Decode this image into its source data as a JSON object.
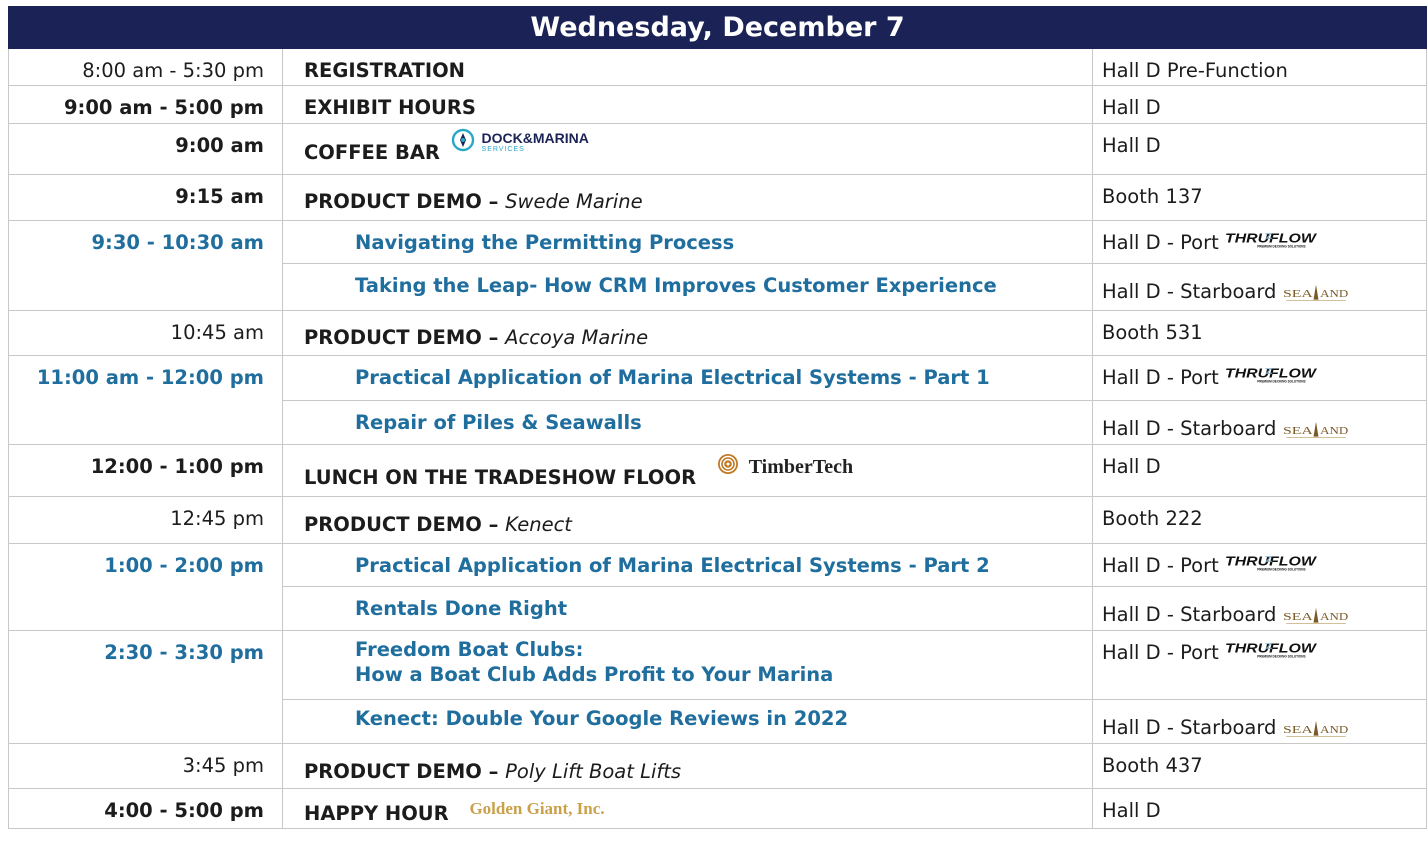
{
  "header": {
    "title": "Wednesday, December 7"
  },
  "rows": {
    "r1": {
      "time": "8:00 am - 5:30 pm",
      "event": "REGISTRATION",
      "location": "Hall D Pre-Function"
    },
    "r2": {
      "time": "9:00 am - 5:00 pm",
      "event": "EXHIBIT HOURS",
      "location": "Hall D"
    },
    "r3": {
      "time": "9:00 am",
      "event": "COFFEE BAR",
      "location": "Hall D",
      "sponsor": "DOCK&MARINA",
      "sponsor_sub": "SERVICES"
    },
    "r4": {
      "time": "9:15 am",
      "event": "PRODUCT DEMO –",
      "event_sub": "Swede Marine",
      "location": "Booth 137"
    },
    "r5": {
      "time": "9:30 - 10:30 am",
      "event": "Navigating the Permitting Process",
      "location": "Hall D - Port"
    },
    "r6": {
      "event": "Taking the Leap- How CRM Improves Customer Experience",
      "location": "Hall D - Starboard"
    },
    "r7": {
      "time": "10:45 am",
      "event": "PRODUCT DEMO –",
      "event_sub": "Accoya Marine",
      "location": "Booth 531"
    },
    "r8": {
      "time": "11:00 am - 12:00 pm",
      "event": "Practical Application of Marina Electrical Systems - Part 1",
      "location": "Hall D - Port"
    },
    "r9": {
      "event": "Repair of Piles & Seawalls",
      "location": "Hall D - Starboard"
    },
    "r10": {
      "time": "12:00 - 1:00 pm",
      "event": "LUNCH ON THE TRADESHOW FLOOR",
      "location": "Hall D",
      "sponsor": "TimberTech"
    },
    "r11": {
      "time": "12:45 pm",
      "event": "PRODUCT DEMO –",
      "event_sub": "Kenect",
      "location": "Booth 222"
    },
    "r12": {
      "time": "1:00 - 2:00 pm",
      "event": "Practical Application of Marina Electrical Systems - Part 2",
      "location": "Hall D - Port"
    },
    "r13": {
      "event": "Rentals Done Right",
      "location": "Hall D - Starboard"
    },
    "r14": {
      "time": "2:30 - 3:30 pm",
      "event_line1": "Freedom Boat Clubs:",
      "event_line2": "How a Boat Club Adds Profit to Your Marina",
      "location": "Hall D - Port"
    },
    "r15": {
      "event": "Kenect: Double Your Google Reviews in 2022",
      "location": "Hall D - Starboard"
    },
    "r16": {
      "time": "3:45 pm",
      "event": "PRODUCT DEMO –",
      "event_sub": "Poly Lift Boat Lifts",
      "location": "Booth 437"
    },
    "r17": {
      "time": "4:00 - 5:00 pm",
      "event": "HAPPY HOUR",
      "location": "Hall D",
      "sponsor": "Golden Giant, Inc."
    }
  },
  "sponsors": {
    "thruflow": {
      "name": "THRUFLOW",
      "tagline": "PREMIUM DECKING SOLUTIONS"
    },
    "sealand": {
      "name": "SEALAND"
    }
  },
  "colors": {
    "header_bg": "#1b2356",
    "session_blue": "#1f6e9e",
    "border": "#c8c8c8",
    "gold": "#c9a14a"
  }
}
